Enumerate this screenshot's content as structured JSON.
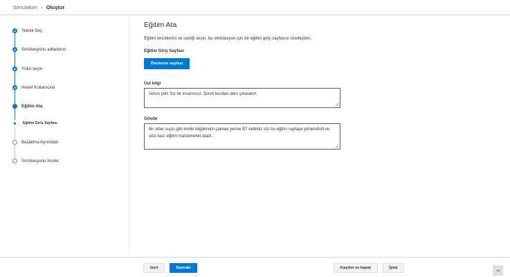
{
  "breadcrumb": {
    "root": "Simulation",
    "current": "Oluştur"
  },
  "steps": [
    {
      "label": "Teknik Seç",
      "state": "completed"
    },
    {
      "label": "Simülasyonu adlandırın",
      "state": "completed"
    },
    {
      "label": "Yükü seçin",
      "state": "completed"
    },
    {
      "label": "Hedef Kullanıcılar",
      "state": "completed"
    },
    {
      "label": "Eğitim Ata",
      "state": "current"
    },
    {
      "label": "Eğitim Giriş Sayfası",
      "state": "current-substep"
    },
    {
      "label": "Başlatma Ayrıntıları",
      "state": "pending"
    },
    {
      "label": "Simülasyonu İncele",
      "state": "pending"
    }
  ],
  "main": {
    "title": "Eğitim Ata",
    "description": "Eğitim tercihlerini ve içeriği seçin, bu simülasyon için bir eğitim giriş sayfasını özelleştirin.",
    "landing_label": "Eğitim Giriş Sayfası",
    "preview_button": "Önizleme sayfası",
    "header_label": "Üst bilgi",
    "header_value": "Sorun yok! Siz bir insansınız. Şimdi bundan ders çıkaralım.",
    "body_label": "Gövde",
    "body_value": "Bir siber suçlu gibi kimlik bilgilerinizi çalmak yerine BT ekibiniz sizi bu eğitici sayfaya yönlendirdi ve size bazı eğitim malzemeleri atadı."
  },
  "footer": {
    "back": "Geri",
    "next": "Sonraki",
    "save_close": "Kaydet ve kapat",
    "cancel": "İptal"
  },
  "colors": {
    "accent": "#0078d4",
    "border": "#e1dfdd",
    "text": "#323130"
  }
}
